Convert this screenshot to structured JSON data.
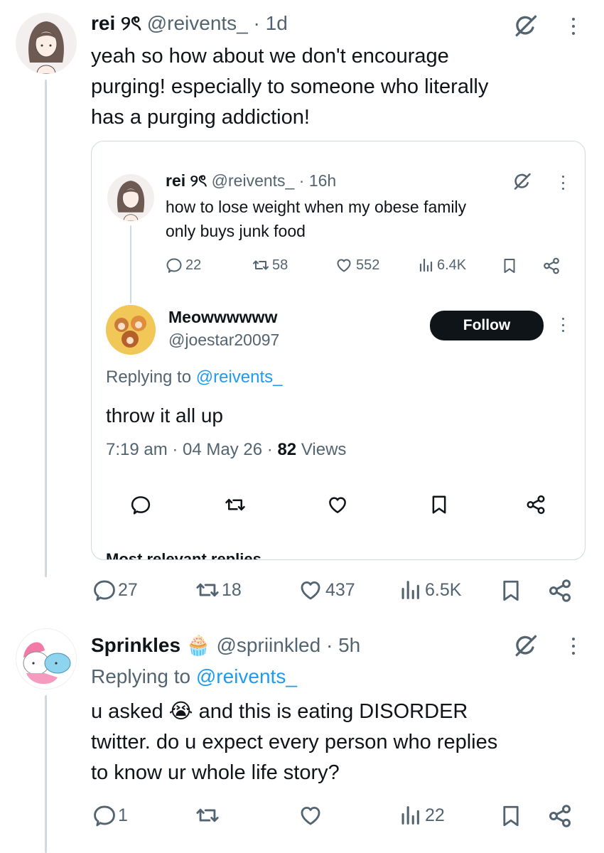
{
  "tweet1": {
    "name": "rei ୨ৎ",
    "handle": "@reivents_",
    "sep": "·",
    "time": "1d",
    "text_line1": "yeah so how about we don't encourage",
    "text_line2": "purging! especially to someone who literally",
    "text_line3": "has a purging addiction!",
    "replies": "27",
    "retweets": "18",
    "likes": "437",
    "views": "6.5K"
  },
  "quote": {
    "original": {
      "name": "rei ୨ৎ",
      "handle": "@reivents_",
      "sep": "·",
      "time": "16h",
      "text_line1": "how to lose weight when my obese family",
      "text_line2": "only buys junk food",
      "replies": "22",
      "retweets": "58",
      "likes": "552",
      "views": "6.4K"
    },
    "reply": {
      "name": "Meowwwwww",
      "handle": "@joestar20097",
      "follow_label": "Follow",
      "replying_prefix": "Replying to ",
      "replying_handle": "@reivents_",
      "text": "throw it all up",
      "time": "7:19 am",
      "date": "04 May 26",
      "views_count": "82",
      "views_label": " Views",
      "sep": " · "
    },
    "more_replies": "Most relevant replies"
  },
  "tweet2": {
    "name": "Sprinkles",
    "emoji": "🧁",
    "handle": "@spriinkled",
    "sep": "·",
    "time": "5h",
    "replying_prefix": "Replying to ",
    "replying_handle": "@reivents_",
    "text_line1a": "u asked ",
    "text_emoji": "😭",
    "text_line1b": " and this is eating DISORDER",
    "text_line2": "twitter. do u expect every person who replies",
    "text_line3": "to know ur whole life story?",
    "replies": "1",
    "views": "22"
  },
  "icons": {
    "grok": "grok-icon",
    "more": "more-icon",
    "reply": "reply-icon",
    "retweet": "retweet-icon",
    "like": "like-icon",
    "views": "views-icon",
    "bookmark": "bookmark-icon",
    "share": "share-icon"
  },
  "colors": {
    "text": "#0f1419",
    "muted": "#536471",
    "link": "#1d9bf0",
    "border": "#cfd9de",
    "follow_bg": "#0f1419"
  }
}
